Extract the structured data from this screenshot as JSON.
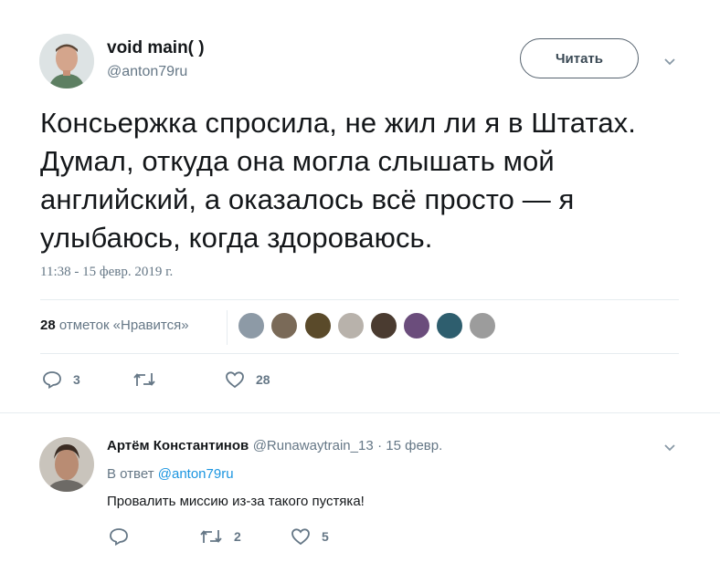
{
  "tweet": {
    "author_name": "void main( )",
    "author_handle": "@anton79ru",
    "follow_label": "Читать",
    "text": "Консьержка спросила, не жил ли я в Штатах. Думал, откуда она могла слышать мой английский, а оказалось всё просто — я улыбаюсь, когда здороваюсь.",
    "timestamp": "11:38 - 15 февр. 2019 г.",
    "likes_number": "28",
    "likes_label": " отметок «Нравится»",
    "replies": "3",
    "retweets": "",
    "favorites": "28",
    "icons": [
      "chevron-down-icon",
      "reply-icon",
      "retweet-icon",
      "heart-icon"
    ]
  },
  "reply": {
    "author_name": "Артём Константинов",
    "author_handle": "@Runawaytrain_13",
    "date": "· 15 февр.",
    "in_reply_prefix": "В ответ ",
    "in_reply_handle": "@anton79ru",
    "text": "Провалить миссию из-за такого пустяка!",
    "replies": "",
    "retweets": "2",
    "favorites": "5"
  },
  "colors": {
    "link": "#1b95e0",
    "secondary": "#657786",
    "primary": "#14171a"
  }
}
